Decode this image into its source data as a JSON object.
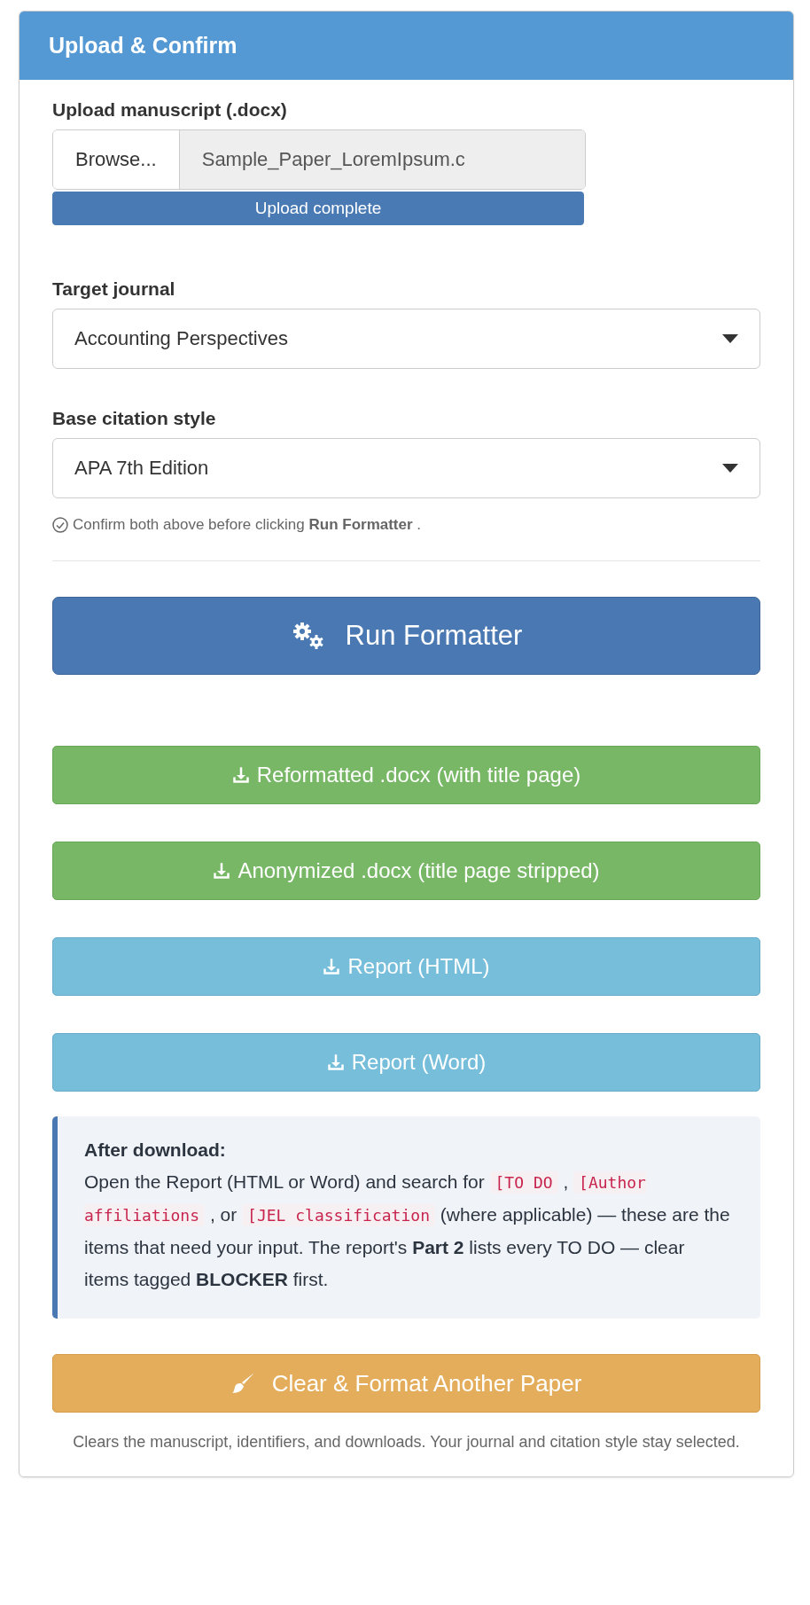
{
  "panel": {
    "title": "Upload & Confirm"
  },
  "upload": {
    "label": "Upload manuscript (.docx)",
    "browse_button": "Browse...",
    "file_name": "Sample_Paper_LoremIpsum.c",
    "progress": {
      "text": "Upload complete",
      "level": 1
    }
  },
  "selects": [
    {
      "label": "Target journal",
      "value": "Accounting Perspectives"
    },
    {
      "label": "Base citation style",
      "value": "APA 7th Edition"
    }
  ],
  "hint": "Confirm both above before clicking **Run Formatter** .",
  "run_button": "Run Formatter",
  "downloads": [
    {
      "label": "Reformatted .docx (with title page)",
      "kind": "success"
    },
    {
      "label": "Anonymized .docx (title page stripped)",
      "kind": "success"
    },
    {
      "label": "Report (HTML)",
      "kind": "info"
    },
    {
      "label": "Report (Word)",
      "kind": "info"
    }
  ],
  "callout": {
    "title": "After download:",
    "segments": [
      {
        "kind": "text",
        "text": "Open the Report (HTML or Word) and search for "
      },
      {
        "kind": "code",
        "text": "[TO DO"
      },
      {
        "kind": "text",
        "text": " , "
      },
      {
        "kind": "code",
        "text": "[Author affiliations"
      },
      {
        "kind": "text",
        "text": " , or "
      },
      {
        "kind": "code",
        "text": "[JEL classification"
      },
      {
        "kind": "text",
        "text": " (where applicable) — these are the items that need your input. The report's "
      },
      {
        "kind": "bold",
        "text": "Part 2"
      },
      {
        "kind": "text",
        "text": " lists every TO DO — clear items tagged "
      },
      {
        "kind": "bold",
        "text": "BLOCKER"
      },
      {
        "kind": "text",
        "text": " first."
      }
    ]
  },
  "clear_button": "Clear & Format Another Paper",
  "footnote": "Clears the manuscript, identifiers, and downloads. Your journal and citation style stay selected."
}
